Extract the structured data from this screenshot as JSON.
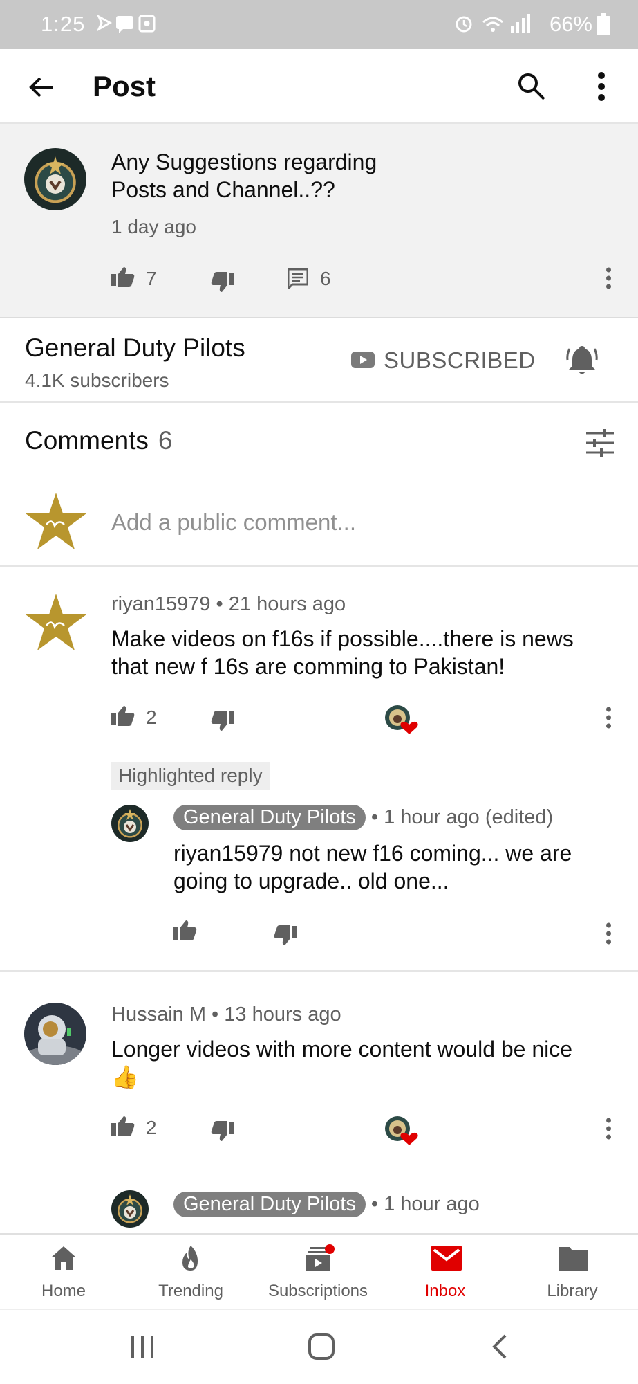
{
  "status_bar": {
    "time": "1:25",
    "battery": "66%"
  },
  "app_bar": {
    "title": "Post"
  },
  "post": {
    "text": "Any Suggestions  regarding\nPosts and Channel..??",
    "age": "1 day ago",
    "likes": "7",
    "comments": "6"
  },
  "channel": {
    "name": "General Duty Pilots",
    "subscribers": "4.1K subscribers",
    "subscribe_label": "SUBSCRIBED"
  },
  "comments_section": {
    "title": "Comments",
    "count": "6",
    "add_placeholder": "Add a public comment..."
  },
  "comments": [
    {
      "author": "riyan15979",
      "age": "21 hours ago",
      "text": "Make videos on f16s if possible....there is news that new f 16s are comming to Pakistan!",
      "likes": "2",
      "highlighted_label": "Highlighted reply",
      "reply": {
        "author": "General Duty Pilots",
        "age": "1 hour ago (edited)",
        "text": "riyan15979 not new f16 coming... we are going to upgrade.. old one..."
      }
    },
    {
      "author": "Hussain M",
      "age": "13 hours ago",
      "text": "Longer videos with more content would be nice",
      "emoji": "👍",
      "likes": "2",
      "reply": {
        "author": "General Duty Pilots",
        "age": "1 hour ago"
      }
    }
  ],
  "bottom_nav": [
    {
      "label": "Home",
      "icon": "home-icon"
    },
    {
      "label": "Trending",
      "icon": "flame-icon"
    },
    {
      "label": "Subscriptions",
      "icon": "subscriptions-icon"
    },
    {
      "label": "Inbox",
      "icon": "inbox-icon",
      "active": true
    },
    {
      "label": "Library",
      "icon": "folder-icon"
    }
  ],
  "colors": {
    "accent": "#e00000",
    "post_bg": "#f2f2f2",
    "text_secondary": "#606060",
    "star_gold": "#b8962e"
  }
}
